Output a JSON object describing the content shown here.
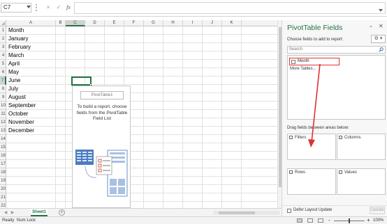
{
  "formula_bar": {
    "name_box": "C7",
    "cancel_icon": "×",
    "enter_icon": "✓",
    "fx_label": "fx",
    "value": ""
  },
  "grid": {
    "columns": [
      "A",
      "B",
      "C",
      "D",
      "E",
      "F",
      "G",
      "H",
      "I",
      "J",
      "K"
    ],
    "selected_column": "C",
    "selected_row": 7,
    "rows": [
      "1",
      "2",
      "3",
      "4",
      "5",
      "6",
      "7",
      "8",
      "9",
      "10",
      "11",
      "12",
      "13",
      "14",
      "15",
      "16",
      "17",
      "18",
      "19",
      "20",
      "21",
      "22"
    ],
    "column_a": [
      "Month",
      "January",
      "February",
      "March",
      "April",
      "May",
      "June",
      "July",
      "August",
      "September",
      "October",
      "November",
      "December"
    ],
    "pivot_placeholder": {
      "name": "PivotTable1",
      "message": "To build a report, choose fields from the PivotTable Field List"
    }
  },
  "sheet_tabs": {
    "tabs": [
      "Sheet1"
    ],
    "active": "Sheet1",
    "add_icon": "+",
    "prev_icon": "◀",
    "next_icon": "▶"
  },
  "status_bar": {
    "ready": "Ready",
    "num_lock": "Num Lock",
    "zoom_minus": "-",
    "zoom_plus": "+",
    "zoom_level": "100%"
  },
  "pivot_pane": {
    "title": "PivotTable Fields",
    "options_icon": "⌄",
    "close_icon": "✕",
    "choose_label": "Choose fields to add to report:",
    "settings_icon": "⚙ ▾",
    "search_placeholder": "Search",
    "fields": [
      {
        "label": "Month",
        "checked": false
      }
    ],
    "more_tables": "More Tables...",
    "drag_label": "Drag fields between areas below:",
    "areas": {
      "filters": "Filters",
      "columns": "Columns",
      "rows": "Rows",
      "values": "Values"
    },
    "defer_label": "Defer Layout Update",
    "update_button": "Update"
  },
  "colors": {
    "excel_green": "#217346",
    "annotation_red": "#e03131"
  }
}
